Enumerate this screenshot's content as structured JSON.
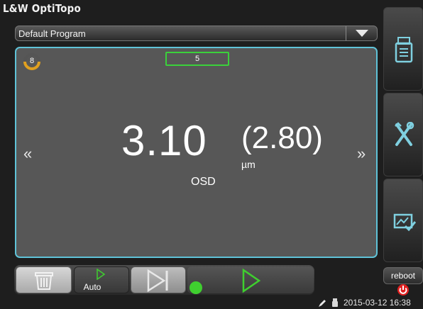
{
  "app": {
    "title": "L&W OptiTopo"
  },
  "program": {
    "selected": "Default Program"
  },
  "panel": {
    "counter": "8",
    "count_box": "5",
    "nav_prev": "«",
    "nav_next": "»",
    "main_value": "3.10",
    "secondary_value": "(2.80)",
    "unit": "µm",
    "measure_label": "OSD"
  },
  "toolbar": {
    "auto_label": "Auto"
  },
  "system": {
    "reboot_label": "reboot",
    "datetime": "2015-03-12 16:38"
  },
  "icons": {
    "dropdown": "chevron-down-icon",
    "report": "printer-report-icon",
    "tools": "wrench-screwdriver-icon",
    "calibrate": "calibration-check-icon",
    "trash": "trash-icon",
    "auto": "auto-play-icon",
    "skip": "skip-next-icon",
    "status_dot": "status-indicator-icon",
    "start": "play-icon",
    "power": "power-icon",
    "tool": "pencil-icon",
    "usb": "usb-icon"
  },
  "colors": {
    "panel_border": "#5fc3d8",
    "count_box_border": "#3bd13b",
    "status_dot": "#3fcf2f",
    "play": "#3fcf2f",
    "power": "#e02020",
    "counter_ring": "#e0a020"
  }
}
